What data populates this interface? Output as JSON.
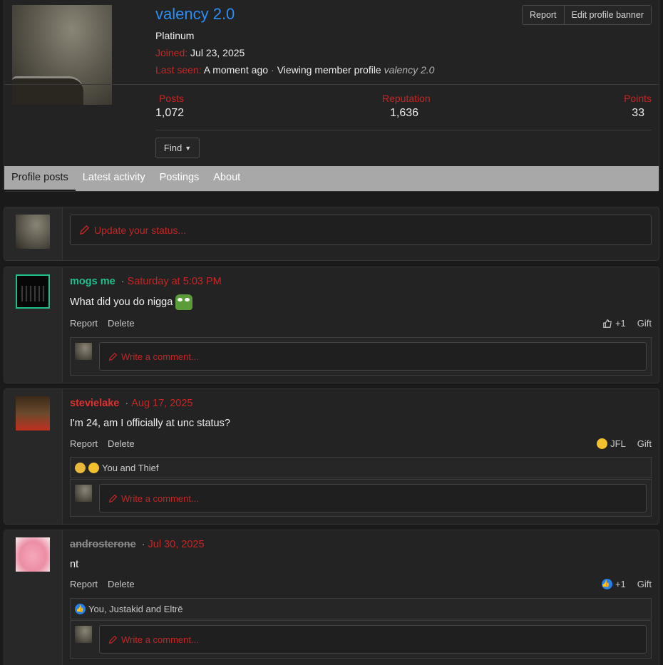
{
  "profile": {
    "username": "valency 2.0",
    "rank": "Platinum",
    "joined_label": "Joined:",
    "joined_value": "Jul 23, 2025",
    "last_seen_label": "Last seen:",
    "last_seen_value": "A moment ago",
    "last_seen_activity": "Viewing member profile",
    "last_seen_target": "valency 2.0",
    "report_button": "Report",
    "edit_banner_button": "Edit profile banner",
    "stats": {
      "posts_label": "Posts",
      "posts_value": "1,072",
      "reputation_label": "Reputation",
      "reputation_value": "1,636",
      "points_label": "Points",
      "points_value": "33"
    },
    "find_button": "Find"
  },
  "tabs": [
    "Profile posts",
    "Latest activity",
    "Postings",
    "About"
  ],
  "status": {
    "placeholder": "Update your status..."
  },
  "comment_placeholder": "Write a comment...",
  "posts": [
    {
      "author": "mogs me",
      "author_color": "#1fbf8e",
      "date": "Saturday at 5:03 PM",
      "message": "What did you do nigga",
      "report": "Report",
      "delete": "Delete",
      "reaction_count": "+1",
      "gift": "Gift"
    },
    {
      "author": "stevielake",
      "author_color": "#e03030",
      "date": "Aug 17, 2025",
      "message": "I'm 24, am I officially at unc status?",
      "report": "Report",
      "delete": "Delete",
      "reaction_label": "JFL",
      "gift": "Gift",
      "reacted_by": "You and Thief"
    },
    {
      "author": "androsterone",
      "author_color": "#8a8a8a",
      "date": "Jul 30, 2025",
      "message": "nt",
      "report": "Report",
      "delete": "Delete",
      "reaction_count": "+1",
      "gift": "Gift",
      "reacted_by": "You, Justakid and Eltrē"
    }
  ]
}
